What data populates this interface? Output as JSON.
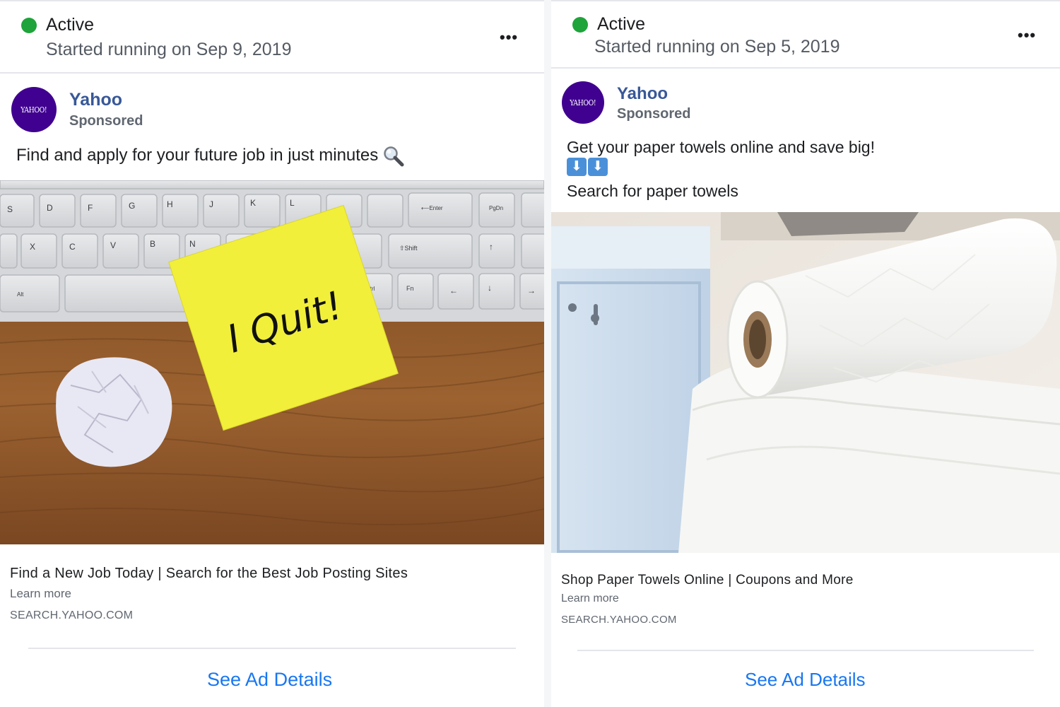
{
  "ads": [
    {
      "status": "Active",
      "started": "Started running on Sep 9, 2019",
      "more_label": "•••",
      "advertiser": "Yahoo",
      "avatar_text": "YAHOO!",
      "sponsored": "Sponsored",
      "body": "Find and apply for your future job in just minutes",
      "body_emoji": "magnifying-glass-icon",
      "image_note_text": "I Quit!",
      "headline": "Find a New Job Today | Search for the Best Job Posting Sites",
      "learn_more": "Learn more",
      "domain": "SEARCH.YAHOO.COM",
      "details_label": "See Ad Details",
      "keyboard_keys_row1": [
        "S",
        "D",
        "F",
        "G",
        "H",
        "J",
        "K",
        "L"
      ],
      "keyboard_keys_row2": [
        "X",
        "C",
        "V",
        "B",
        "N"
      ],
      "keyboard_special": [
        "Enter",
        "PgDn",
        "Shift",
        "Ctrl",
        "Fn",
        "Alt"
      ]
    },
    {
      "status": "Active",
      "started": "Started running on Sep 5, 2019",
      "more_label": "•••",
      "advertiser": "Yahoo",
      "avatar_text": "YAHOO!",
      "sponsored": "Sponsored",
      "body_line1": "Get your paper towels online and save big!",
      "body_emoji": [
        "down-arrow-icon",
        "down-arrow-icon"
      ],
      "emoji_glyph": "⬇",
      "body_line3": "Search for paper towels",
      "headline": "Shop Paper Towels Online | Coupons and More",
      "learn_more": "Learn more",
      "domain": "SEARCH.YAHOO.COM",
      "details_label": "See Ad Details"
    }
  ],
  "colors": {
    "active_dot": "#1fa33b",
    "brand_purple": "#400090",
    "page_name": "#385898",
    "link_blue": "#1877f2"
  }
}
